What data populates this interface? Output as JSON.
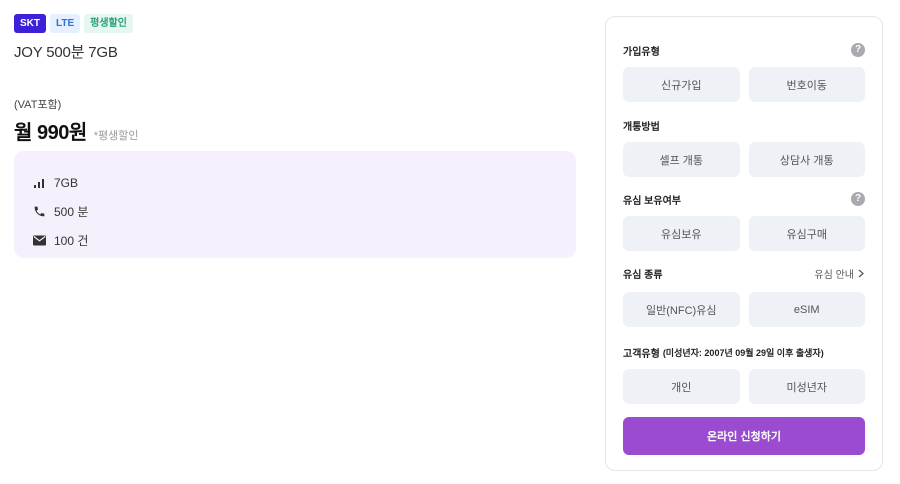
{
  "badges": {
    "carrier": "SKT",
    "network": "LTE",
    "discount": "평생할인"
  },
  "plan": {
    "name": "JOY 500분 7GB",
    "vat_label": "(VAT포함)",
    "price": "월 990원",
    "price_note": "*평생할인"
  },
  "specs": {
    "data": "7GB",
    "voice": "500 분",
    "sms": "100 건"
  },
  "form": {
    "join_type": {
      "title": "가입유형",
      "options": [
        "신규가입",
        "번호이동"
      ]
    },
    "activation": {
      "title": "개통방법",
      "options": [
        "셀프 개통",
        "상담사 개통"
      ]
    },
    "sim_owned": {
      "title": "유심 보유여부",
      "options": [
        "유심보유",
        "유심구매"
      ]
    },
    "sim_kind": {
      "title": "유심 종류",
      "guide_link": "유심 안내",
      "options": [
        "일반(NFC)유심",
        "eSIM"
      ]
    },
    "customer_type": {
      "title": "고객유형",
      "title_note": "(미성년자: 2007년 09월 29일 이후 출생자)",
      "options": [
        "개인",
        "미성년자"
      ]
    },
    "submit_label": "온라인 신청하기"
  },
  "colors": {
    "skt": "#3b22d8",
    "accent": "#9a4bd0",
    "spec_bg": "#f5f0fb",
    "option_bg": "#eef1f6"
  },
  "icons": {
    "data": "signal-bars-icon",
    "voice": "phone-icon",
    "sms": "envelope-icon",
    "help": "question-circle-icon",
    "chevron": "chevron-right-icon"
  }
}
